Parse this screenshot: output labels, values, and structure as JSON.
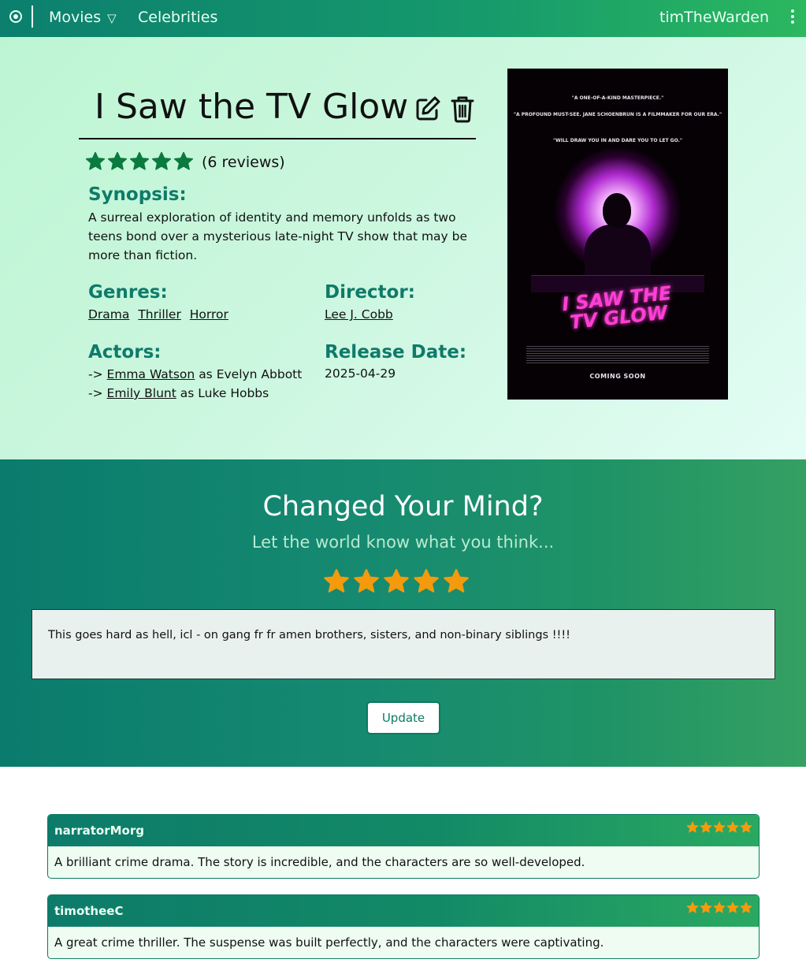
{
  "nav": {
    "movies_label": "Movies",
    "celebrities_label": "Celebrities",
    "username": "timTheWarden",
    "icons": {
      "logo": "target-icon",
      "menu": "kebab-menu-icon",
      "dropdown": "triangle-down-icon"
    }
  },
  "movie": {
    "title": "I Saw the TV Glow",
    "rating_stars": 5,
    "reviews_count_text": "(6 reviews)",
    "synopsis_label": "Synopsis:",
    "synopsis": "A surreal exploration of identity and memory unfolds as two teens bond over a mysterious late-night TV show that may be more than fiction.",
    "genres_label": "Genres:",
    "genres": [
      "Drama",
      "Thriller",
      "Horror"
    ],
    "director_label": "Director:",
    "director": "Lee J. Cobb",
    "actors_label": "Actors:",
    "actors": [
      {
        "prefix": "->",
        "name": "Emma Watson",
        "role": "as Evelyn Abbott"
      },
      {
        "prefix": "->",
        "name": "Emily Blunt",
        "role": "as Luke Hobbs"
      }
    ],
    "release_label": "Release Date:",
    "release_date": "2025-04-29",
    "icons": {
      "edit": "edit-icon",
      "delete": "trash-icon"
    },
    "poster": {
      "quote1": "\"A ONE-OF-A-KIND MASTERPIECE.\"",
      "quote2": "\"A PROFOUND MUST-SEE. JANE SCHOENBRUN IS A FILMMAKER FOR OUR ERA.\"",
      "quote3": "\"WILL DRAW YOU IN AND DARE YOU TO LET GO.\"",
      "title_line1": "I SAW THE",
      "title_line2": "TV GLOW",
      "coming": "COMING SOON"
    }
  },
  "review_form": {
    "title": "Changed Your Mind?",
    "subtitle": "Let the world know what you think...",
    "rating_stars": 5,
    "text": "This goes hard as hell, icl - on gang fr fr amen brothers, sisters, and non-binary siblings !!!!",
    "button_label": "Update"
  },
  "reviews": [
    {
      "user": "narratorMorg",
      "stars": 5,
      "text": "A brilliant crime drama. The story is incredible, and the characters are so well-developed."
    },
    {
      "user": "timotheeC",
      "stars": 5,
      "text": "A great crime thriller. The suspense was built perfectly, and the characters were captivating."
    }
  ],
  "colors": {
    "accent_green": "#0f7a6a",
    "star_dark_green": "#0b7a3e",
    "star_orange": "#f59a0c"
  }
}
